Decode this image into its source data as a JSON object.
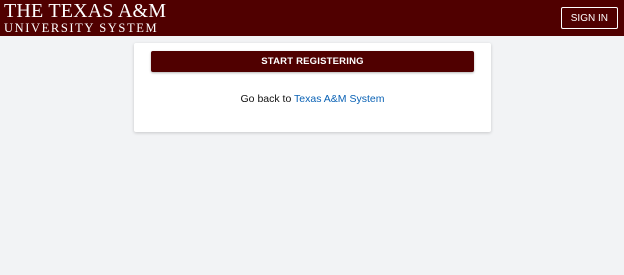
{
  "header": {
    "logo_line1": "THE TEXAS A&M",
    "logo_line2": "UNIVERSITY SYSTEM",
    "sign_in_label": "SIGN IN",
    "background_color": "#500000"
  },
  "card": {
    "start_button_label": "START REGISTERING",
    "back_prefix": "Go back to",
    "back_link_label": "Texas A&M System",
    "link_color": "#0a62b5"
  }
}
